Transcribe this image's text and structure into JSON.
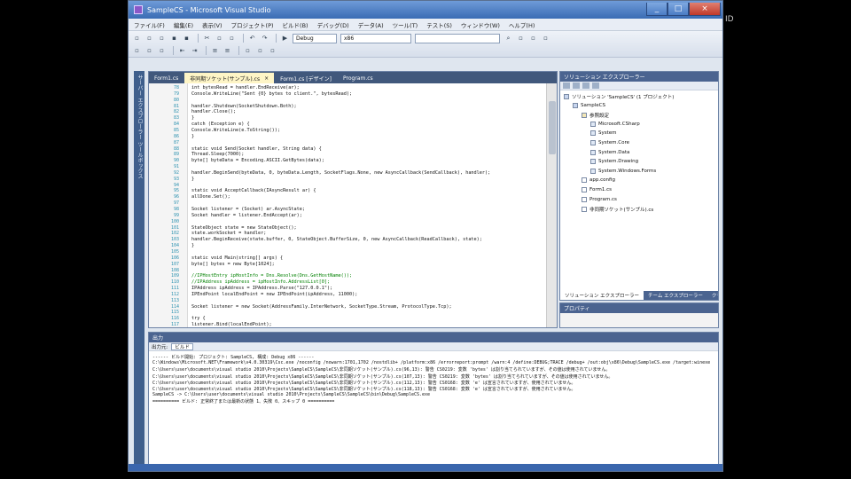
{
  "window": {
    "title": "SampleCS - Microsoft Visual Studio",
    "controls": {
      "minimize": "_",
      "maximize": "□",
      "close": "×"
    }
  },
  "background": {
    "mark": "ID"
  },
  "menu": [
    "ファイル(F)",
    "編集(E)",
    "表示(V)",
    "プロジェクト(P)",
    "ビルド(B)",
    "デバッグ(D)",
    "データ(A)",
    "ツール(T)",
    "テスト(S)",
    "ウィンドウ(W)",
    "ヘルプ(H)"
  ],
  "toolbar": {
    "config": "Debug",
    "platform": "x86",
    "search": ""
  },
  "left_strip": {
    "label": "サーバー エクスプローラー  ツールボックス"
  },
  "editor": {
    "tabs": [
      {
        "label": "Form1.cs",
        "active": false
      },
      {
        "label": "非同期ソケット(サンプル).cs",
        "active": true
      },
      {
        "label": "Form1.cs [デザイン]",
        "active": false
      },
      {
        "label": "Program.cs",
        "active": false
      }
    ],
    "lines": [
      {
        "n": "78",
        "text": "        int bytesRead = handler.EndReceive(ar);",
        "kind": "code"
      },
      {
        "n": "79",
        "text": "        Console.WriteLine(\"Sent {0} bytes to client.\", bytesRead);",
        "kind": "code"
      },
      {
        "n": "80",
        "text": "",
        "kind": "code"
      },
      {
        "n": "81",
        "text": "        handler.Shutdown(SocketShutdown.Both);",
        "kind": "code"
      },
      {
        "n": "82",
        "text": "        handler.Close();",
        "kind": "code"
      },
      {
        "n": "83",
        "text": "    }",
        "kind": "code"
      },
      {
        "n": "84",
        "text": "    catch (Exception e) {",
        "kind": "code"
      },
      {
        "n": "85",
        "text": "        Console.WriteLine(e.ToString());",
        "kind": "code"
      },
      {
        "n": "86",
        "text": "    }",
        "kind": "code"
      },
      {
        "n": "87",
        "text": "",
        "kind": "code"
      },
      {
        "n": "88",
        "text": "static void Send(Socket handler, String data) {",
        "kind": "code"
      },
      {
        "n": "89",
        "text": "    Thread.Sleep(7000);",
        "kind": "code"
      },
      {
        "n": "90",
        "text": "    byte[] byteData = Encoding.ASCII.GetBytes(data);",
        "kind": "code"
      },
      {
        "n": "91",
        "text": "",
        "kind": "code"
      },
      {
        "n": "92",
        "text": "    handler.BeginSend(byteData, 0, byteData.Length, SocketFlags.None, new AsyncCallback(SendCallback), handler);",
        "kind": "code"
      },
      {
        "n": "93",
        "text": "}",
        "kind": "code"
      },
      {
        "n": "94",
        "text": "",
        "kind": "code"
      },
      {
        "n": "95",
        "text": "static void AcceptCallback(IAsyncResult ar) {",
        "kind": "code"
      },
      {
        "n": "96",
        "text": "    allDone.Set();",
        "kind": "code"
      },
      {
        "n": "97",
        "text": "",
        "kind": "code"
      },
      {
        "n": "98",
        "text": "    Socket listener = (Socket) ar.AsyncState;",
        "kind": "code"
      },
      {
        "n": "99",
        "text": "    Socket handler = listener.EndAccept(ar);",
        "kind": "code"
      },
      {
        "n": "100",
        "text": "",
        "kind": "code"
      },
      {
        "n": "101",
        "text": "    StateObject state = new StateObject();",
        "kind": "code"
      },
      {
        "n": "102",
        "text": "    state.workSocket = handler;",
        "kind": "code"
      },
      {
        "n": "103",
        "text": "    handler.BeginReceive(state.buffer, 0, StateObject.BufferSize, 0, new AsyncCallback(ReadCallback), state);",
        "kind": "code"
      },
      {
        "n": "104",
        "text": "}",
        "kind": "code"
      },
      {
        "n": "105",
        "text": "",
        "kind": "code"
      },
      {
        "n": "106",
        "text": "static void Main(string[] args) {",
        "kind": "code"
      },
      {
        "n": "107",
        "text": "    byte[] bytes = new Byte[1024];",
        "kind": "code"
      },
      {
        "n": "108",
        "text": "",
        "kind": "code"
      },
      {
        "n": "109",
        "text": "    //IPHostEntry ipHostInfo = Dns.Resolve(Dns.GetHostName());",
        "kind": "comment"
      },
      {
        "n": "110",
        "text": "    //IPAddress ipAddress = ipHostInfo.AddressList[0];",
        "kind": "comment"
      },
      {
        "n": "111",
        "text": "    IPAddress ipAddress = IPAddress.Parse(\"127.0.0.1\");",
        "kind": "code"
      },
      {
        "n": "112",
        "text": "    IPEndPoint localEndPoint = new IPEndPoint(ipAddress, 11000);",
        "kind": "code"
      },
      {
        "n": "113",
        "text": "",
        "kind": "code"
      },
      {
        "n": "114",
        "text": "    Socket listener = new Socket(AddressFamily.InterNetwork, SocketType.Stream, ProtocolType.Tcp);",
        "kind": "code"
      },
      {
        "n": "115",
        "text": "",
        "kind": "code"
      },
      {
        "n": "116",
        "text": "    try {",
        "kind": "code"
      },
      {
        "n": "117",
        "text": "        listener.Bind(localEndPoint);",
        "kind": "code"
      }
    ]
  },
  "solution_explorer": {
    "title": "ソリューション エクスプローラー",
    "items": [
      {
        "label": "ソリューション 'SampleCS' (1 プロジェクト)",
        "depth": 0,
        "icon": "solution"
      },
      {
        "label": "SampleCS",
        "depth": 1,
        "icon": "project"
      },
      {
        "label": "参照設定",
        "depth": 2,
        "icon": "folder"
      },
      {
        "label": "Microsoft.CSharp",
        "depth": 3,
        "icon": "ref"
      },
      {
        "label": "System",
        "depth": 3,
        "icon": "ref"
      },
      {
        "label": "System.Core",
        "depth": 3,
        "icon": "ref"
      },
      {
        "label": "System.Data",
        "depth": 3,
        "icon": "ref"
      },
      {
        "label": "System.Drawing",
        "depth": 3,
        "icon": "ref"
      },
      {
        "label": "System.Windows.Forms",
        "depth": 3,
        "icon": "ref"
      },
      {
        "label": "app.config",
        "depth": 2,
        "icon": "file"
      },
      {
        "label": "Form1.cs",
        "depth": 2,
        "icon": "file"
      },
      {
        "label": "Program.cs",
        "depth": 2,
        "icon": "file"
      },
      {
        "label": "非同期ソケット(サンプル).cs",
        "depth": 2,
        "icon": "file"
      }
    ],
    "tabs": [
      {
        "label": "ソリューション エクスプローラー",
        "active": true
      },
      {
        "label": "チーム エクスプローラー",
        "active": false
      },
      {
        "label": "クラス ビュー",
        "active": false
      }
    ]
  },
  "properties": {
    "title": "プロパティ"
  },
  "output": {
    "title": "出力",
    "show_from_label": "出力元:",
    "show_from_value": "ビルド",
    "lines": [
      "------ ビルド開始: プロジェクト: SampleCS, 構成: Debug x86 ------",
      "C:\\Windows\\Microsoft.NET\\Framework\\v4.0.30319\\Csc.exe /noconfig /nowarn:1701,1702 /nostdlib+ /platform:x86 /errorreport:prompt /warn:4 /define:DEBUG;TRACE /debug+ /out:obj\\x86\\Debug\\SampleCS.exe /target:winexe",
      "C:\\Users\\user\\documents\\visual studio 2010\\Projects\\SampleCS\\SampleCS\\非同期ソケット(サンプル).cs(96,13): 警告 CS0219: 変数 'bytes' は割り当てられていますが、その値は使用されていません。",
      "C:\\Users\\user\\documents\\visual studio 2010\\Projects\\SampleCS\\SampleCS\\非同期ソケット(サンプル).cs(107,13): 警告 CS0219: 変数 'bytes' は割り当てられていますが、その値は使用されていません。",
      "C:\\Users\\user\\documents\\visual studio 2010\\Projects\\SampleCS\\SampleCS\\非同期ソケット(サンプル).cs(112,13): 警告 CS0168: 変数 'e' は宣言されていますが、使用されていません。",
      "C:\\Users\\user\\documents\\visual studio 2010\\Projects\\SampleCS\\SampleCS\\非同期ソケット(サンプル).cs(118,13): 警告 CS0168: 変数 'e' は宣言されていますが、使用されていません。",
      "  SampleCS -> C:\\Users\\user\\documents\\visual studio 2010\\Projects\\SampleCS\\SampleCS\\bin\\Debug\\SampleCS.exe",
      "========== ビルド: 正常終了または最新の状態 1、失敗 0、スキップ 0 =========="
    ]
  },
  "colors": {
    "titlebar": "#3a6cb4",
    "panel_header": "#4b6490",
    "keyword": "#0000ff",
    "comment": "#008000",
    "line_number": "#2b91af"
  }
}
